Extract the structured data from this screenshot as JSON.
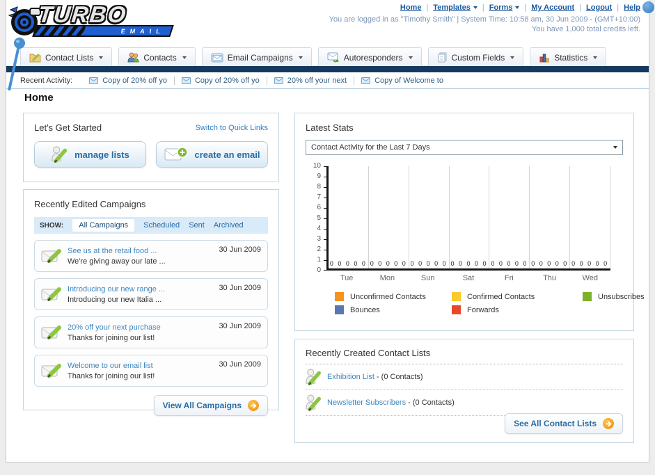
{
  "header": {
    "logo": {
      "title": "TURBO",
      "subtitle": "EMAIL"
    },
    "nav_links": [
      {
        "label": "Home"
      },
      {
        "label": "Templates"
      },
      {
        "label": "Forms"
      },
      {
        "label": "My Account"
      },
      {
        "label": "Logout"
      },
      {
        "label": "Help"
      }
    ],
    "login_info": "You are logged in as \"Timothy Smith\" | System Time: 10:58 am, 30 Jun 2009 - (GMT+10:00)",
    "credits": "You have 1,000 total credits left."
  },
  "main_nav": {
    "items": [
      {
        "label": "Contact Lists"
      },
      {
        "label": "Contacts"
      },
      {
        "label": "Email Campaigns"
      },
      {
        "label": "Autoresponders"
      },
      {
        "label": "Custom Fields"
      },
      {
        "label": "Statistics"
      }
    ]
  },
  "recent_activity": {
    "label": "Recent Activity:",
    "items": [
      "Copy of 20% off yo",
      "Copy of 20% off yo",
      "20% off your next",
      "Copy of Welcome to"
    ]
  },
  "page": {
    "title": "Home"
  },
  "get_started": {
    "title": "Let's Get Started",
    "switch_link": "Switch to Quick Links",
    "manage_lists_label": "manage lists",
    "create_email_label": "create an email"
  },
  "campaigns": {
    "title": "Recently Edited Campaigns",
    "show_label": "SHOW:",
    "tabs": [
      {
        "label": "All Campaigns",
        "selected": true
      },
      {
        "label": "Scheduled",
        "selected": false
      },
      {
        "label": "Sent",
        "selected": false
      },
      {
        "label": "Archived",
        "selected": false
      }
    ],
    "items": [
      {
        "title": "See us at the retail food ...",
        "subtitle": "We're giving away our late ...",
        "date": "30 Jun 2009"
      },
      {
        "title": "Introducing our new range ...",
        "subtitle": "Introducing our new Italia ...",
        "date": "30 Jun 2009"
      },
      {
        "title": "20% off your next purchase",
        "subtitle": "Thanks for joining our list!",
        "date": "30 Jun 2009"
      },
      {
        "title": "Welcome to our email list",
        "subtitle": "Thanks for joining our list!",
        "date": "30 Jun 2009"
      }
    ],
    "view_all_label": "View All Campaigns"
  },
  "stats": {
    "title": "Latest Stats",
    "filter_value": "Contact Activity for the Last 7 Days"
  },
  "chart_data": {
    "type": "bar",
    "title": "Contact Activity for the Last 7 Days",
    "categories": [
      "Tue",
      "Mon",
      "Sun",
      "Sat",
      "Fri",
      "Thu",
      "Wed"
    ],
    "series": [
      {
        "name": "Unconfirmed Contacts",
        "color": "#F6921E",
        "values": [
          0,
          0,
          0,
          0,
          0,
          0,
          0
        ]
      },
      {
        "name": "Confirmed Contacts",
        "color": "#FBC92B",
        "values": [
          0,
          0,
          0,
          0,
          0,
          0,
          0
        ]
      },
      {
        "name": "Unsubscribes",
        "color": "#7CB228",
        "values": [
          0,
          0,
          0,
          0,
          0,
          0,
          0
        ]
      },
      {
        "name": "Bounces",
        "color": "#5B77AE",
        "values": [
          0,
          0,
          0,
          0,
          0,
          0,
          0
        ]
      },
      {
        "name": "Forwards",
        "color": "#E8472A",
        "values": [
          0,
          0,
          0,
          0,
          0,
          0,
          0
        ]
      }
    ],
    "ylim": [
      0,
      10
    ],
    "yticks": [
      0,
      1,
      2,
      3,
      4,
      5,
      6,
      7,
      8,
      9,
      10
    ],
    "grid": true,
    "legend_position": "bottom"
  },
  "contact_lists": {
    "title": "Recently Created Contact Lists",
    "items": [
      {
        "name": "Exhibition List",
        "suffix": " - (0 Contacts)"
      },
      {
        "name": "Newsletter Subscribers",
        "suffix": " - (0 Contacts)"
      }
    ],
    "see_all_label": "See All Contact Lists"
  }
}
